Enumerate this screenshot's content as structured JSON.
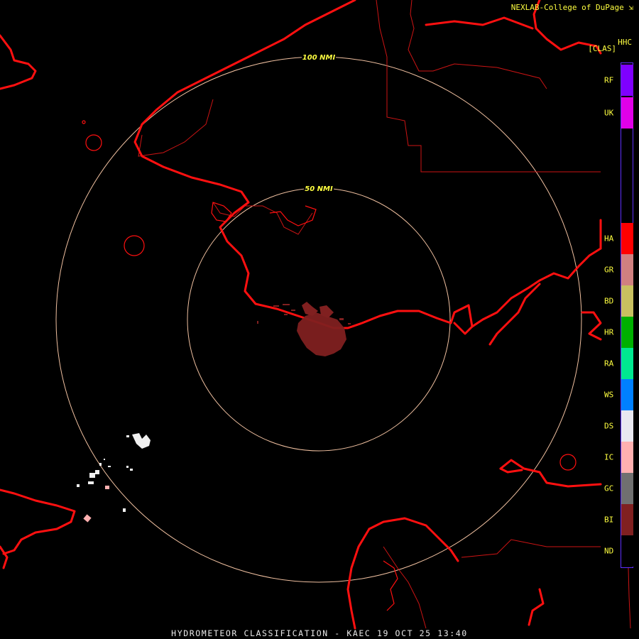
{
  "header": {
    "credit": "NEXLAB-College of DuPage",
    "credit_icon": "external-link-icon",
    "product_code": "HHC",
    "class_label": "[CLAS]"
  },
  "rings": [
    {
      "label": "100 NMI"
    },
    {
      "label": "50 NMI"
    }
  ],
  "legend": {
    "items": [
      {
        "label": "RF",
        "color": "#7f00ff"
      },
      {
        "label": "UK",
        "color": "#e000e8"
      },
      {
        "label": "HA",
        "color": "#ff0000"
      },
      {
        "label": "GR",
        "color": "#d08080"
      },
      {
        "label": "BD",
        "color": "#c8c060"
      },
      {
        "label": "HR",
        "color": "#00b000"
      },
      {
        "label": "RA",
        "color": "#00e890"
      },
      {
        "label": "WS",
        "color": "#0080ff"
      },
      {
        "label": "DS",
        "color": "#e8e8f0"
      },
      {
        "label": "IC",
        "color": "#ffb0b0"
      },
      {
        "label": "GC",
        "color": "#707070"
      },
      {
        "label": "BI",
        "color": "#802020"
      },
      {
        "label": "ND",
        "color": "#000000"
      }
    ]
  },
  "colors": {
    "coastline": "#ff1010",
    "border": "#cc1414",
    "range_ring": "#f0c0a0",
    "ground_clutter_echo": "#802020",
    "dry_snow_echo": "#f0f0f0"
  },
  "footer": {
    "title": "HYDROMETEOR CLASSIFICATION - KAEC 19 OCT 25 13:40"
  }
}
